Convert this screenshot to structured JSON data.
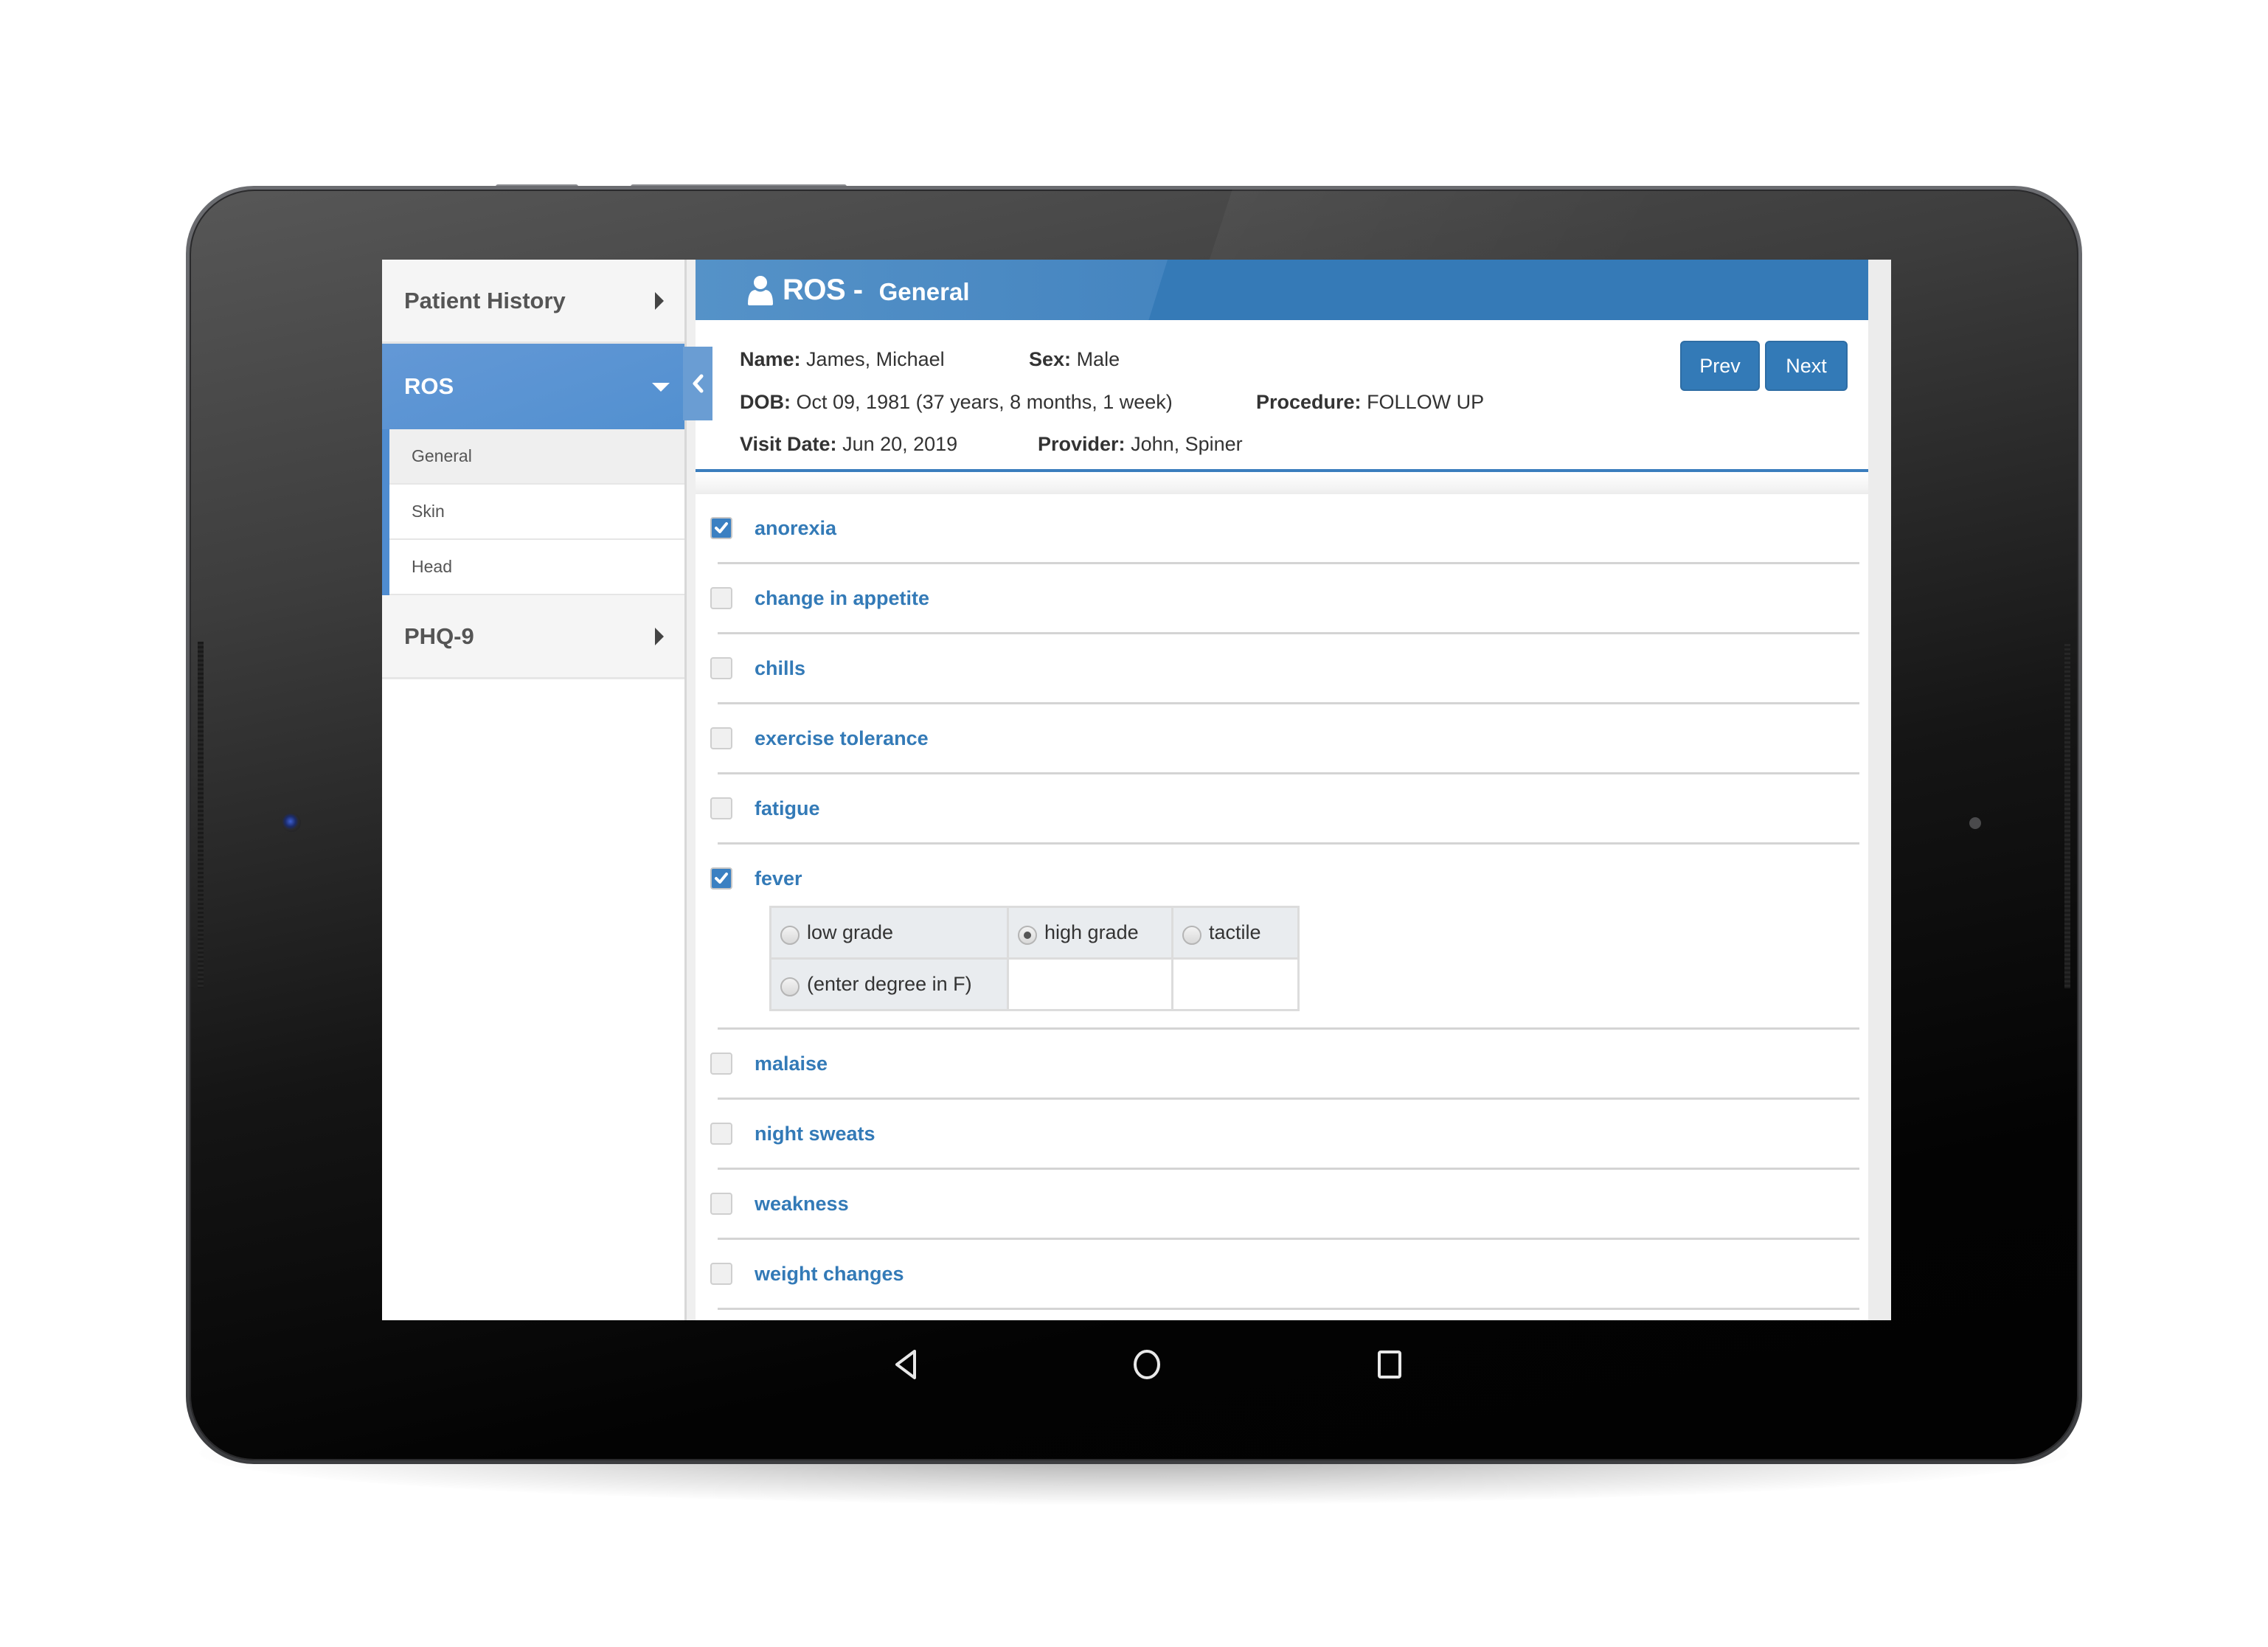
{
  "sidebar": {
    "sections": [
      {
        "label": "Patient History",
        "expanded": false
      },
      {
        "label": "ROS",
        "expanded": true,
        "items": [
          {
            "label": "General",
            "selected": true
          },
          {
            "label": "Skin",
            "selected": false
          },
          {
            "label": "Head",
            "selected": false
          }
        ]
      },
      {
        "label": "PHQ-9",
        "expanded": false
      }
    ],
    "collapse_icon": "chevron-left-icon"
  },
  "header": {
    "icon": "user-icon",
    "title": "ROS -",
    "subtitle": "General"
  },
  "patient": {
    "name_label": "Name:",
    "name": "James, Michael",
    "sex_label": "Sex:",
    "sex": "Male",
    "dob_label": "DOB:",
    "dob": "Oct 09, 1981 (37 years, 8 months, 1 week)",
    "procedure_label": "Procedure:",
    "procedure": "FOLLOW UP",
    "visit_date_label": "Visit Date:",
    "visit_date": "Jun 20, 2019",
    "provider_label": "Provider:",
    "provider": "John, Spiner"
  },
  "buttons": {
    "prev": "Prev",
    "next": "Next"
  },
  "symptoms": [
    {
      "label": "anorexia",
      "checked": true
    },
    {
      "label": "change in appetite",
      "checked": false
    },
    {
      "label": "chills",
      "checked": false
    },
    {
      "label": "exercise tolerance",
      "checked": false
    },
    {
      "label": "fatigue",
      "checked": false
    },
    {
      "label": "fever",
      "checked": true
    },
    {
      "label": "malaise",
      "checked": false
    },
    {
      "label": "night sweats",
      "checked": false
    },
    {
      "label": "weakness",
      "checked": false
    },
    {
      "label": "weight changes",
      "checked": false
    }
  ],
  "fever_options": {
    "selected": "high grade",
    "options": [
      "low grade",
      "high grade",
      "tactile",
      "(enter degree in F)"
    ]
  },
  "android_nav": {
    "back": "back-icon",
    "home": "home-icon",
    "recents": "recents-icon"
  },
  "colors": {
    "accent": "#337ab7",
    "sidebar_active": "#5b94d3",
    "checked": "#3b80c2"
  }
}
